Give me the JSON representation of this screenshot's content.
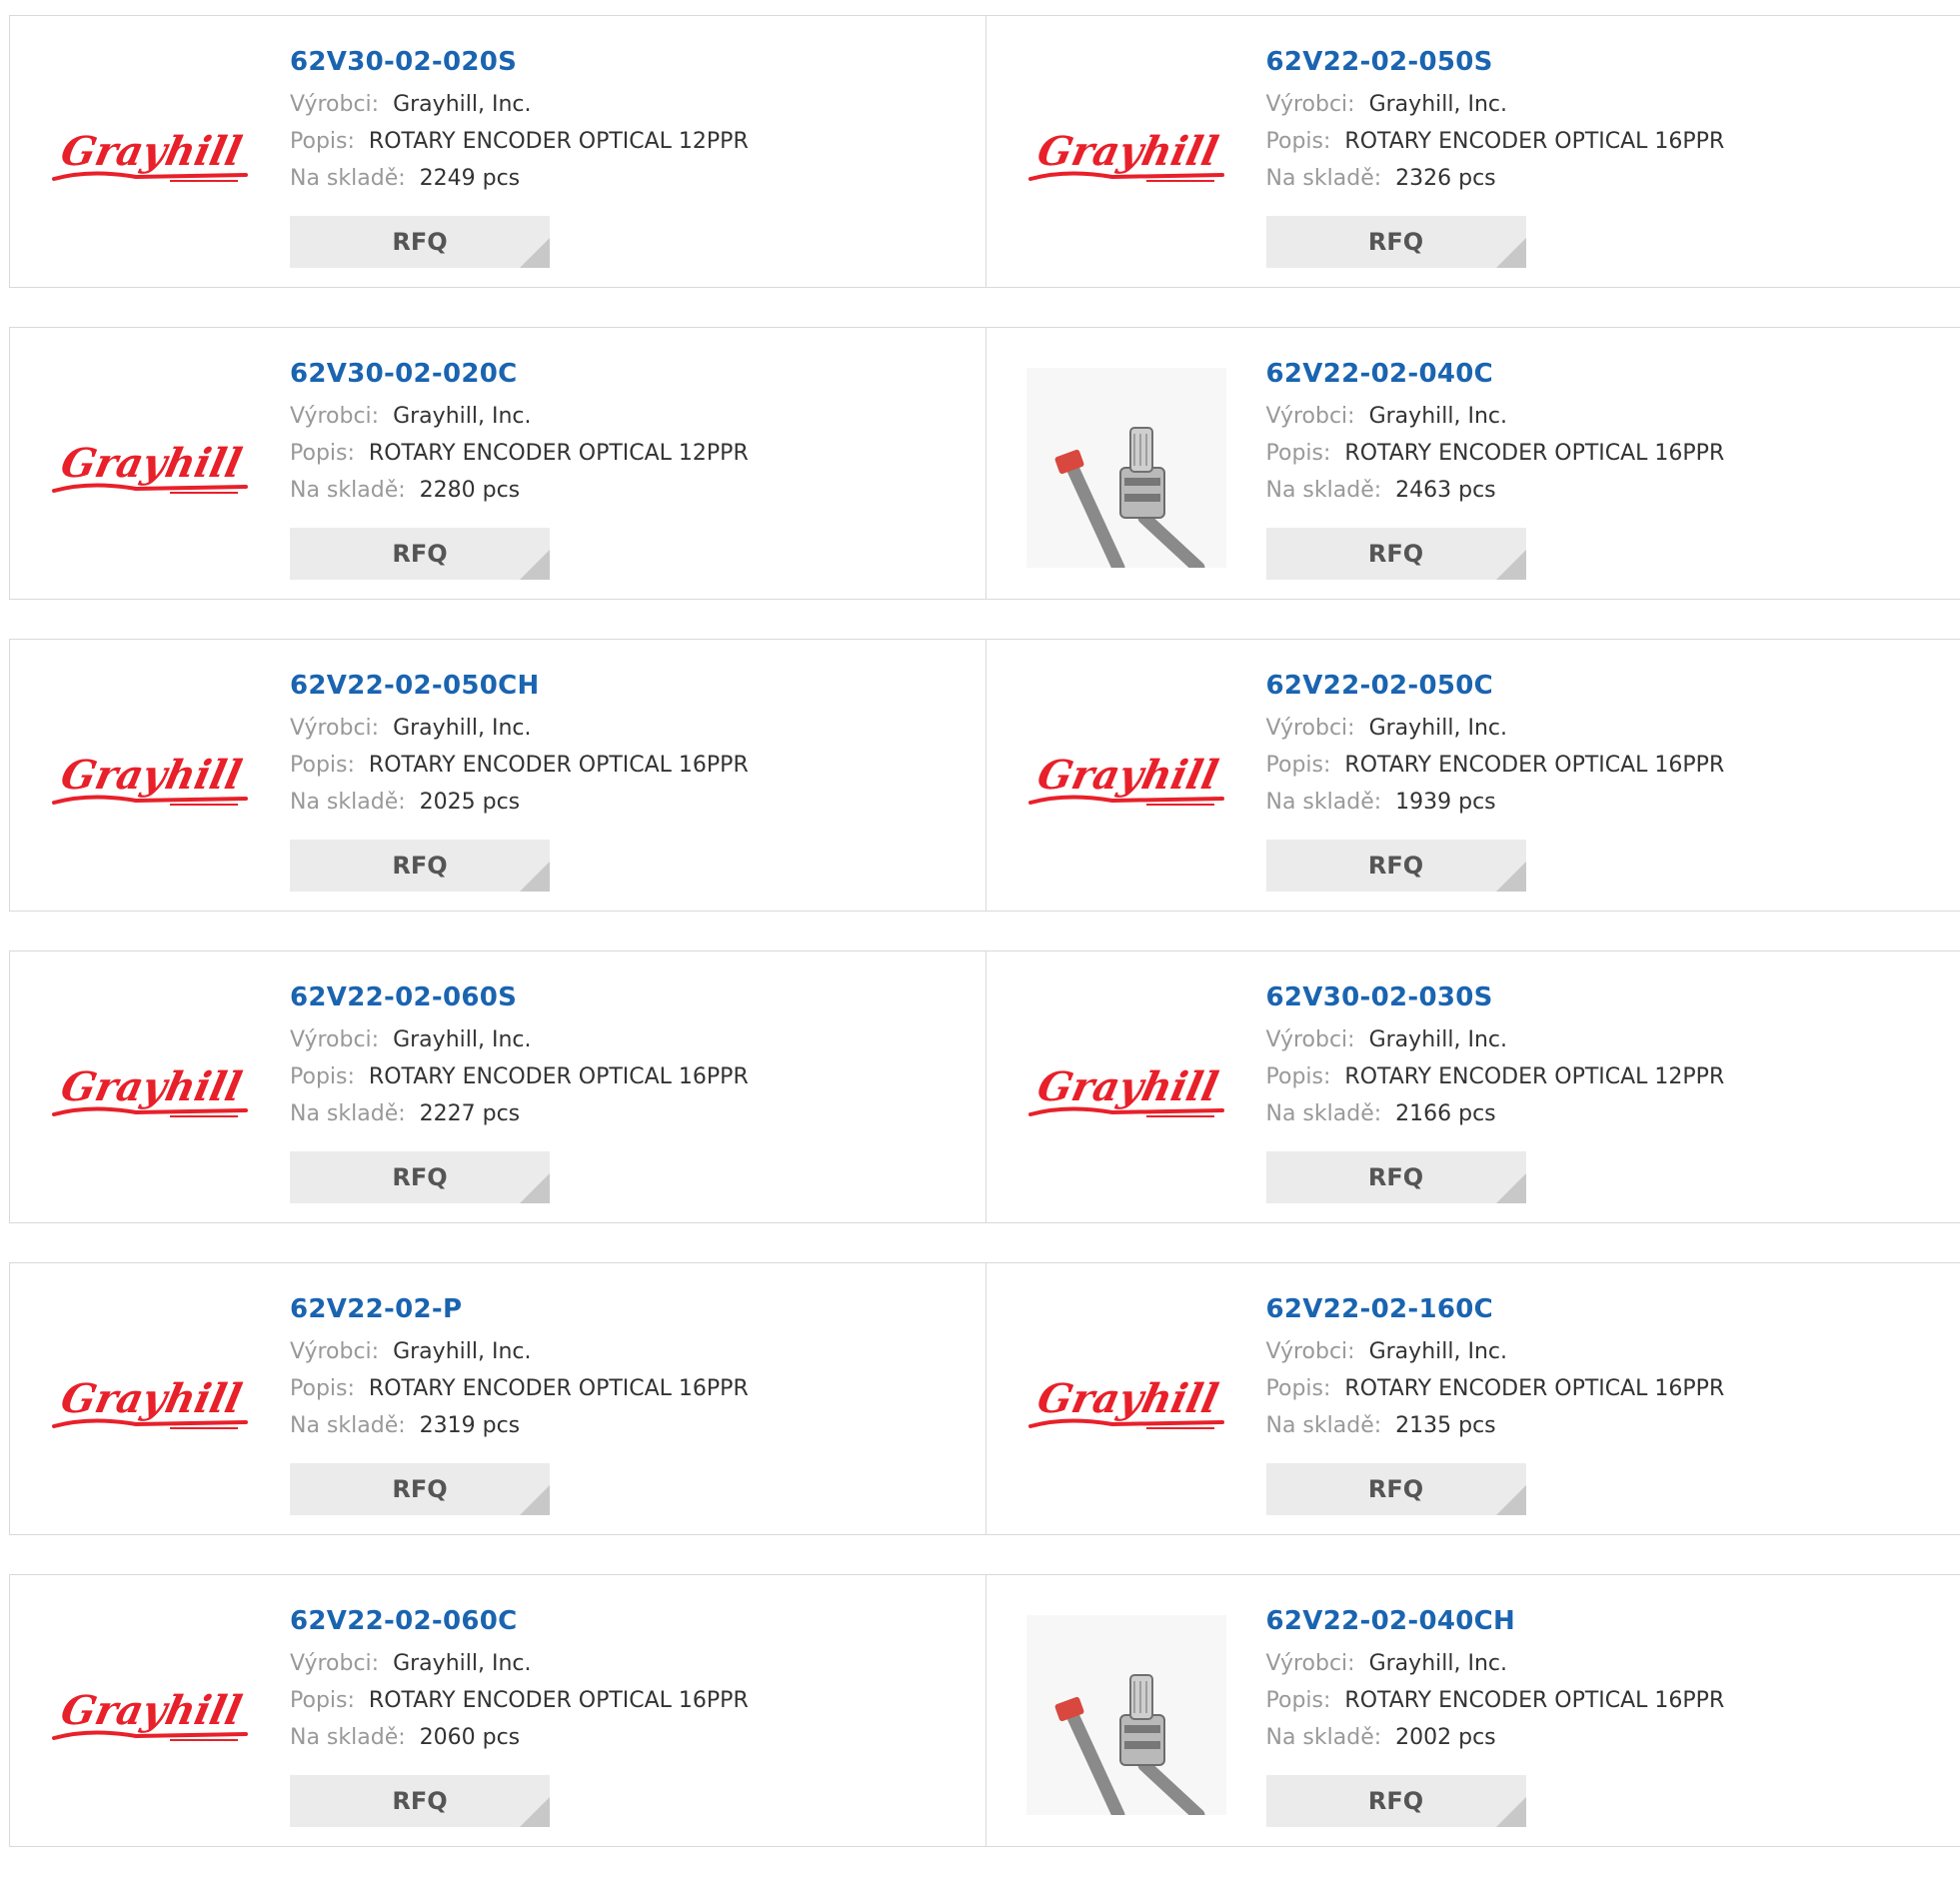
{
  "labels": {
    "manufacturer": "Výrobci:",
    "description": "Popis:",
    "stock": "Na skladě:",
    "rfq": "RFQ"
  },
  "colors": {
    "part_link": "#1a64b0",
    "label": "#999999",
    "value": "#333333",
    "button_bg": "#ebebeb",
    "logo_red": "#e8202a"
  },
  "rows": [
    [
      {
        "part": "62V30-02-020S",
        "manufacturer": "Grayhill, Inc.",
        "description": "ROTARY ENCODER OPTICAL 12PPR",
        "stock": "2249 pcs",
        "image": "grayhill-logo",
        "logo_text": "Grayhill"
      },
      {
        "part": "62V22-02-050S",
        "manufacturer": "Grayhill, Inc.",
        "description": "ROTARY ENCODER OPTICAL 16PPR",
        "stock": "2326 pcs",
        "image": "grayhill-logo",
        "logo_text": "Grayhill"
      }
    ],
    [
      {
        "part": "62V30-02-020C",
        "manufacturer": "Grayhill, Inc.",
        "description": "ROTARY ENCODER OPTICAL 12PPR",
        "stock": "2280 pcs",
        "image": "grayhill-logo",
        "logo_text": "Grayhill"
      },
      {
        "part": "62V22-02-040C",
        "manufacturer": "Grayhill, Inc.",
        "description": "ROTARY ENCODER OPTICAL 16PPR",
        "stock": "2463 pcs",
        "image": "encoder-photo",
        "logo_text": ""
      }
    ],
    [
      {
        "part": "62V22-02-050CH",
        "manufacturer": "Grayhill, Inc.",
        "description": "ROTARY ENCODER OPTICAL 16PPR",
        "stock": "2025 pcs",
        "image": "grayhill-logo",
        "logo_text": "Grayhill"
      },
      {
        "part": "62V22-02-050C",
        "manufacturer": "Grayhill, Inc.",
        "description": "ROTARY ENCODER OPTICAL 16PPR",
        "stock": "1939 pcs",
        "image": "grayhill-logo",
        "logo_text": "Grayhill"
      }
    ],
    [
      {
        "part": "62V22-02-060S",
        "manufacturer": "Grayhill, Inc.",
        "description": "ROTARY ENCODER OPTICAL 16PPR",
        "stock": "2227 pcs",
        "image": "grayhill-logo",
        "logo_text": "Grayhill"
      },
      {
        "part": "62V30-02-030S",
        "manufacturer": "Grayhill, Inc.",
        "description": "ROTARY ENCODER OPTICAL 12PPR",
        "stock": "2166 pcs",
        "image": "grayhill-logo",
        "logo_text": "Grayhill"
      }
    ],
    [
      {
        "part": "62V22-02-P",
        "manufacturer": "Grayhill, Inc.",
        "description": "ROTARY ENCODER OPTICAL 16PPR",
        "stock": "2319 pcs",
        "image": "grayhill-logo",
        "logo_text": "Grayhill"
      },
      {
        "part": "62V22-02-160C",
        "manufacturer": "Grayhill, Inc.",
        "description": "ROTARY ENCODER OPTICAL 16PPR",
        "stock": "2135 pcs",
        "image": "grayhill-logo",
        "logo_text": "Grayhill"
      }
    ],
    [
      {
        "part": "62V22-02-060C",
        "manufacturer": "Grayhill, Inc.",
        "description": "ROTARY ENCODER OPTICAL 16PPR",
        "stock": "2060 pcs",
        "image": "grayhill-logo",
        "logo_text": "Grayhill"
      },
      {
        "part": "62V22-02-040CH",
        "manufacturer": "Grayhill, Inc.",
        "description": "ROTARY ENCODER OPTICAL 16PPR",
        "stock": "2002 pcs",
        "image": "encoder-photo",
        "logo_text": ""
      }
    ]
  ]
}
